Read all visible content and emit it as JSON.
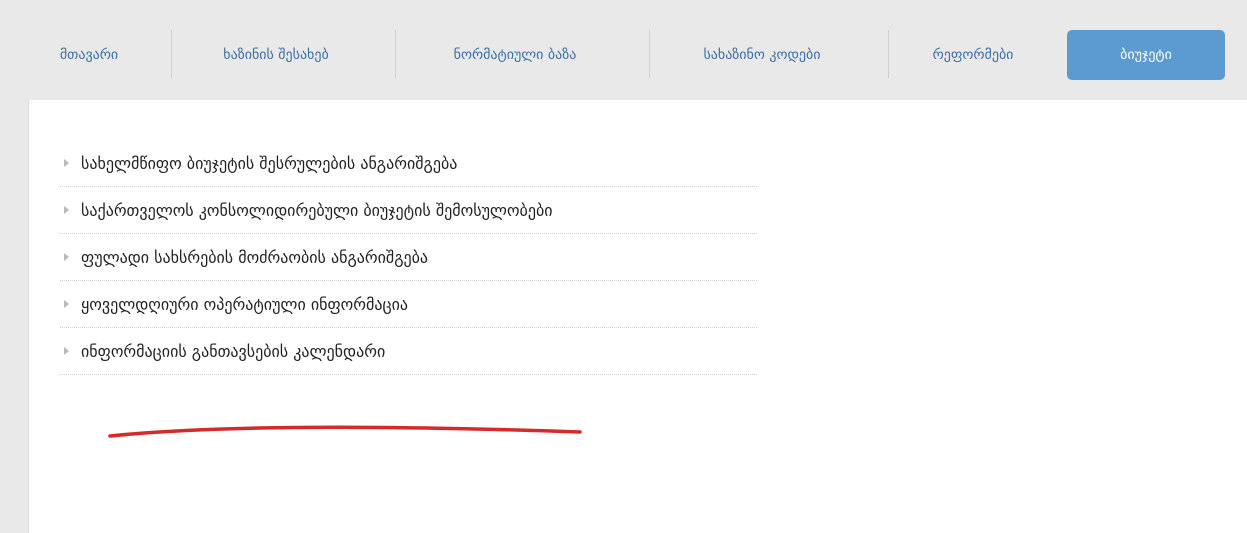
{
  "nav": {
    "items": [
      {
        "label": "მთავარი"
      },
      {
        "label": "ხაზინის შესახებ"
      },
      {
        "label": "ნორმატიული ბაზა"
      },
      {
        "label": "სახაზინო კოდები"
      },
      {
        "label": "რეფორმები"
      },
      {
        "label": "ბიუჯეტი"
      }
    ],
    "active_color": "#5b9bd1",
    "link_color": "#3a6fa8"
  },
  "links": {
    "items": [
      {
        "label": "სახელმწიფო ბიუჯეტის შესრულების ანგარიშგება"
      },
      {
        "label": "საქართველოს კონსოლიდირებული ბიუჯეტის შემოსულობები"
      },
      {
        "label": "ფულადი სახსრების მოძრაობის ანგარიშგება"
      },
      {
        "label": "ყოველდღიური ოპერატიული ინფორმაცია"
      },
      {
        "label": "ინფორმაციის განთავსების კალენდარი"
      }
    ],
    "arrow_icon": "triangle-right-icon",
    "annotation_color": "#d42a2a"
  }
}
